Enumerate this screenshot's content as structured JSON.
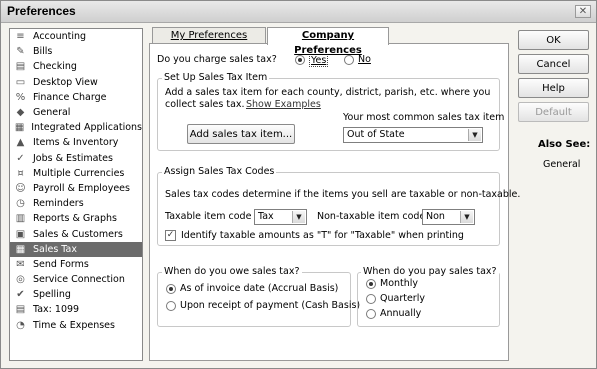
{
  "window": {
    "title": "Preferences",
    "close_icon": "✕"
  },
  "sidebar": {
    "items": [
      {
        "label": "Accounting",
        "icon": "ledger-icon",
        "glyph": "≡",
        "selected": false
      },
      {
        "label": "Bills",
        "icon": "bills-icon",
        "glyph": "✎",
        "selected": false
      },
      {
        "label": "Checking",
        "icon": "checking-icon",
        "glyph": "▤",
        "selected": false
      },
      {
        "label": "Desktop View",
        "icon": "desktop-icon",
        "glyph": "▭",
        "selected": false
      },
      {
        "label": "Finance Charge",
        "icon": "finance-icon",
        "glyph": "%",
        "selected": false
      },
      {
        "label": "General",
        "icon": "general-icon",
        "glyph": "◆",
        "selected": false
      },
      {
        "label": "Integrated Applications",
        "icon": "apps-icon",
        "glyph": "▦",
        "selected": false
      },
      {
        "label": "Items & Inventory",
        "icon": "inventory-icon",
        "glyph": "▲",
        "selected": false
      },
      {
        "label": "Jobs & Estimates",
        "icon": "jobs-icon",
        "glyph": "✓",
        "selected": false
      },
      {
        "label": "Multiple Currencies",
        "icon": "currency-icon",
        "glyph": "¤",
        "selected": false
      },
      {
        "label": "Payroll & Employees",
        "icon": "payroll-icon",
        "glyph": "☺",
        "selected": false
      },
      {
        "label": "Reminders",
        "icon": "reminders-icon",
        "glyph": "◷",
        "selected": false
      },
      {
        "label": "Reports & Graphs",
        "icon": "reports-icon",
        "glyph": "▥",
        "selected": false
      },
      {
        "label": "Sales & Customers",
        "icon": "sales-icon",
        "glyph": "▣",
        "selected": false
      },
      {
        "label": "Sales Tax",
        "icon": "sales-tax-icon",
        "glyph": "▦",
        "selected": true
      },
      {
        "label": "Send Forms",
        "icon": "send-forms-icon",
        "glyph": "✉",
        "selected": false
      },
      {
        "label": "Service Connection",
        "icon": "service-icon",
        "glyph": "◎",
        "selected": false
      },
      {
        "label": "Spelling",
        "icon": "spelling-icon",
        "glyph": "✔",
        "selected": false
      },
      {
        "label": "Tax: 1099",
        "icon": "tax1099-icon",
        "glyph": "▤",
        "selected": false
      },
      {
        "label": "Time & Expenses",
        "icon": "time-icon",
        "glyph": "◔",
        "selected": false
      }
    ]
  },
  "tabs": {
    "my": "My Preferences",
    "company": "Company Preferences"
  },
  "charge_tax": {
    "question": "Do you charge sales tax?",
    "yes": "Yes",
    "no": "No"
  },
  "setup": {
    "title": "Set Up Sales Tax Item",
    "line1": "Add a sales tax item for each county, district, parish, etc. where you",
    "line2": "collect sales tax.",
    "show_examples": "Show Examples",
    "add_button": "Add sales tax item...",
    "common_label": "Your most common sales tax item",
    "common_value": "Out of State"
  },
  "codes": {
    "title": "Assign Sales Tax Codes",
    "description": "Sales tax codes determine if the items you sell are taxable or non-taxable.",
    "taxable_label": "Taxable item code",
    "taxable_value": "Tax",
    "nontaxable_label": "Non-taxable item code",
    "nontaxable_value": "Non",
    "identify_label": "Identify taxable amounts as \"T\" for \"Taxable\" when printing"
  },
  "owe": {
    "title": "When do you owe sales tax?",
    "accrual": "As of invoice date (Accrual Basis)",
    "cash": "Upon receipt of payment (Cash Basis)"
  },
  "pay": {
    "title": "When do you pay sales tax?",
    "monthly": "Monthly",
    "quarterly": "Quarterly",
    "annually": "Annually"
  },
  "buttons": {
    "ok": "OK",
    "cancel": "Cancel",
    "help": "Help",
    "default": "Default"
  },
  "also_see": {
    "title": "Also See:",
    "general": "General"
  }
}
